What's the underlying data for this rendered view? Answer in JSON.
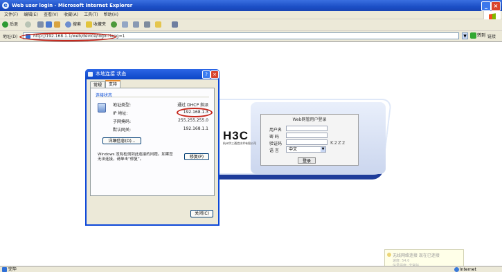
{
  "window": {
    "title": "Web user login - Microsoft Internet Explorer"
  },
  "menu": [
    "文件(F)",
    "编辑(E)",
    "查看(V)",
    "收藏(A)",
    "工具(T)",
    "帮助(H)"
  ],
  "toolbar": {
    "back_label": "后退",
    "search_label": "搜索",
    "favorites_label": "收藏夹"
  },
  "address": {
    "label": "地址(D)",
    "url": "http://192.168.1.1/web/device/login?lang=1",
    "go_label": "转到",
    "links_label": "链接"
  },
  "dialog": {
    "title": "本地连接 状态",
    "tabs": [
      "常规",
      "支持"
    ],
    "group_title": "连接状态",
    "fields": [
      {
        "label": "地址类型:",
        "value": "通过 DHCP 指派"
      },
      {
        "label": "IP 地址:",
        "value": "192.168.1.3"
      },
      {
        "label": "子网掩码:",
        "value": "255.255.255.0"
      },
      {
        "label": "默认网关:",
        "value": "192.168.1.1"
      }
    ],
    "details_button": "详细信息(D)...",
    "repair_text": "Windows 没有检测到此连接的问题。如果您无法连接，请单击“修复”。",
    "repair_button": "修复(P)",
    "close_button": "关闭(C)"
  },
  "login": {
    "logo": "H3C",
    "logo_sub": "杭州华三通信技术有限公司",
    "title": "Web网管用户登录",
    "username_label": "用户名",
    "password_label": "密 码",
    "captcha_label": "验证码",
    "captcha_value": "K2Z2",
    "language_label": "语 言",
    "language_value": "中文",
    "login_button": "登录"
  },
  "balloon": {
    "title": "无线网络连接 现在已连接",
    "line1": "速度: 54.0",
    "line2": "信号强度: 非常好"
  },
  "status": {
    "left": "完毕",
    "zone": "Internet"
  }
}
